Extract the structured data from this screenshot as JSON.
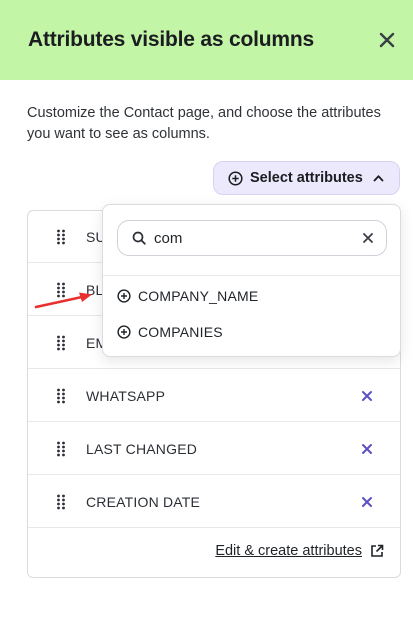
{
  "panel": {
    "title": "Attributes visible as columns",
    "description": "Customize the Contact page, and choose the attributes you want to see as columns.",
    "select_button_label": "Select attributes",
    "edit_link_label": "Edit & create attributes"
  },
  "rows": [
    {
      "label": "SU"
    },
    {
      "label": "BL"
    },
    {
      "label": "EM"
    },
    {
      "label": "WHATSAPP"
    },
    {
      "label": "LAST CHANGED"
    },
    {
      "label": "CREATION DATE"
    }
  ],
  "dropdown": {
    "search_value": "com",
    "options": [
      {
        "label": "COMPANY_NAME"
      },
      {
        "label": "COMPANIES"
      }
    ]
  },
  "colors": {
    "header_bg": "#c3f5a7",
    "accent": "#5b4fc4",
    "select_bg": "#ebe9fb",
    "arrow": "#e8312f"
  },
  "icons": [
    "close-icon",
    "plus-circle-icon",
    "chevron-up-icon",
    "drag-handle-icon",
    "remove-icon",
    "search-icon",
    "clear-icon",
    "external-link-icon"
  ]
}
